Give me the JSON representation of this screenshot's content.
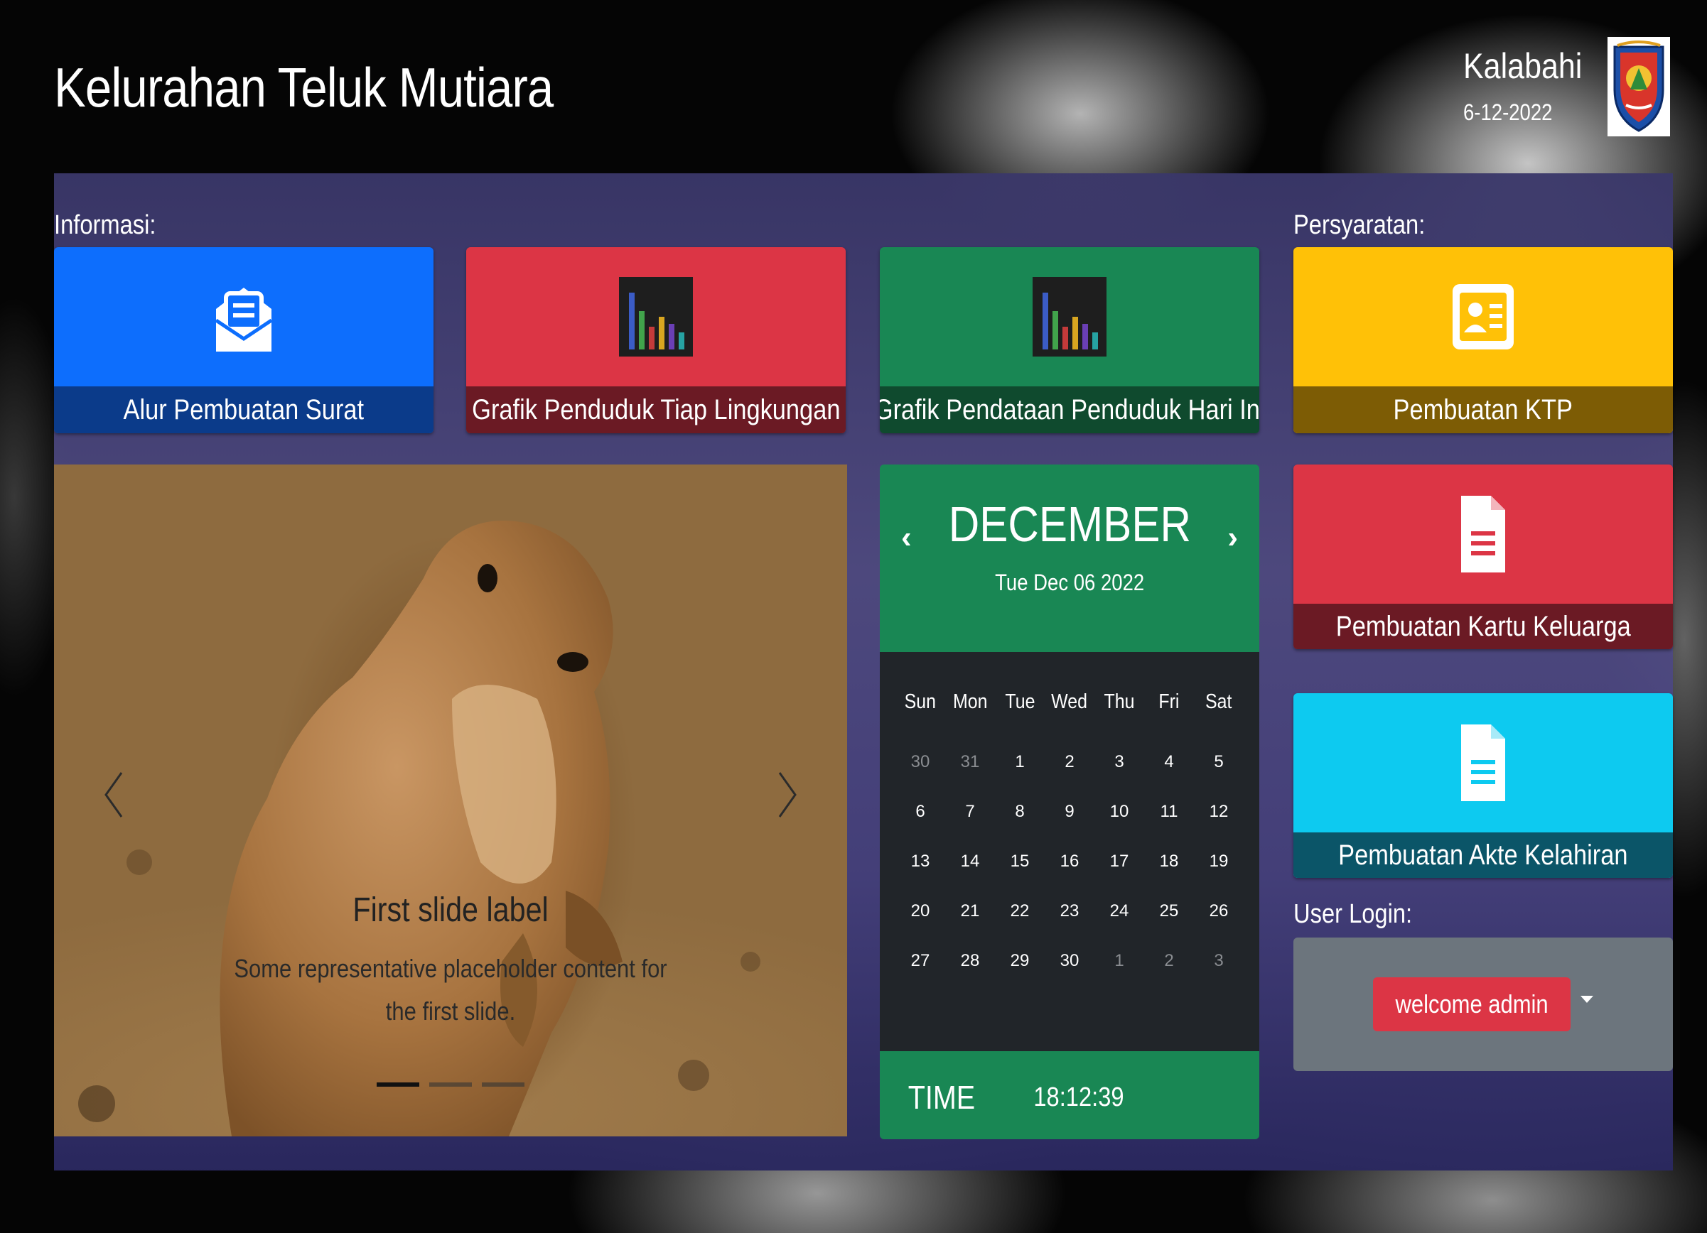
{
  "header": {
    "title": "Kelurahan Teluk Mutiara",
    "city": "Kalabahi",
    "date": "6-12-2022",
    "logo_icon": "regency-crest-icon"
  },
  "sections": {
    "info_label": "Informasi:",
    "requirements_label": "Persyaratan:",
    "user_login_label": "User Login:"
  },
  "tiles": {
    "alur": {
      "label": "Alur Pembuatan Surat",
      "icon": "envelope-letter-icon",
      "color": "#0d6efd",
      "foot_color": "#0b3b8a"
    },
    "grafik_lingkungan": {
      "label": "Grafik Penduduk Tiap Lingkungan",
      "icon": "bar-chart-icon",
      "color": "#dc3545",
      "foot_color": "#6b1a24"
    },
    "grafik_hari_ini": {
      "label": "Grafik Pendataan Penduduk Hari Ini",
      "icon": "bar-chart-icon",
      "color": "#198754",
      "foot_color": "#0f4a2e"
    },
    "ktp": {
      "label": "Pembuatan KTP",
      "icon": "id-card-icon",
      "color": "#ffc107",
      "foot_color": "#7d5c05"
    },
    "kk": {
      "label": "Pembuatan Kartu Keluarga",
      "icon": "document-icon",
      "color": "#dc3545",
      "foot_color": "#6b1a24"
    },
    "akte": {
      "label": "Pembuatan Akte Kelahiran",
      "icon": "document-icon",
      "color": "#0dcaf0",
      "foot_color": "#0b5568"
    }
  },
  "carousel": {
    "slide_title": "First slide label",
    "slide_text": "Some representative placeholder content for the first slide.",
    "prev_icon": "chevron-left-icon",
    "next_icon": "chevron-right-icon",
    "indicators": 3,
    "active_index": 0
  },
  "calendar": {
    "month": "DECEMBER",
    "full_date": "Tue Dec 06 2022",
    "weekdays": [
      "Sun",
      "Mon",
      "Tue",
      "Wed",
      "Thu",
      "Fri",
      "Sat"
    ],
    "weeks": [
      [
        "30",
        "31",
        "1",
        "2",
        "3",
        "4",
        "5"
      ],
      [
        "6",
        "7",
        "8",
        "9",
        "10",
        "11",
        "12"
      ],
      [
        "13",
        "14",
        "15",
        "16",
        "17",
        "18",
        "19"
      ],
      [
        "20",
        "21",
        "22",
        "23",
        "24",
        "25",
        "26"
      ],
      [
        "27",
        "28",
        "29",
        "30",
        "1",
        "2",
        "3"
      ]
    ],
    "muted": [
      [
        0,
        0
      ],
      [
        0,
        1
      ],
      [
        4,
        4
      ],
      [
        4,
        5
      ],
      [
        4,
        6
      ]
    ],
    "time_label": "TIME",
    "time_value": "18:12:39"
  },
  "user": {
    "welcome": "welcome admin"
  },
  "colors": {
    "green": "#198754",
    "dark": "#212529",
    "gray": "#6c757d",
    "red": "#dc3545"
  }
}
